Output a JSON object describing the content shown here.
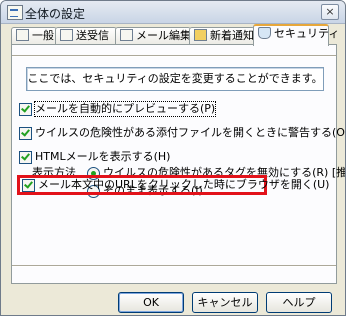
{
  "window": {
    "title": "全体の設定",
    "close_symbol": "×"
  },
  "tabs": [
    {
      "label": "一般"
    },
    {
      "label": "送受信"
    },
    {
      "label": "メール編集"
    },
    {
      "label": "新着通知"
    },
    {
      "label": "セキュリティ"
    }
  ],
  "notice": "ここでは、セキュリティの設定を変更することができます。",
  "options": {
    "preview": {
      "label": "メールを自動的にプレビューする(P)",
      "checked": true
    },
    "warn_attach": {
      "label": "ウイルスの危険性がある添付ファイルを開くときに警告する(O)",
      "checked": true
    },
    "html_mail": {
      "label": "HTMLメールを表示する(H)",
      "checked": true
    },
    "display_method": {
      "label": "表示方法",
      "choices": [
        {
          "label": "ウイルスの危険性があるタグを無効にする(R) [推奨]",
          "selected": true
        },
        {
          "label": "そのまま表示する(I)",
          "selected": false
        }
      ]
    },
    "url_browser": {
      "label": "メール本文中のURLをクリックした時にブラウザを開く(U)",
      "checked": true
    }
  },
  "buttons": {
    "ok": "OK",
    "cancel": "キャンセル",
    "help": "ヘルプ"
  },
  "colors": {
    "highlight": "#e2121a",
    "check": "#21a121"
  }
}
